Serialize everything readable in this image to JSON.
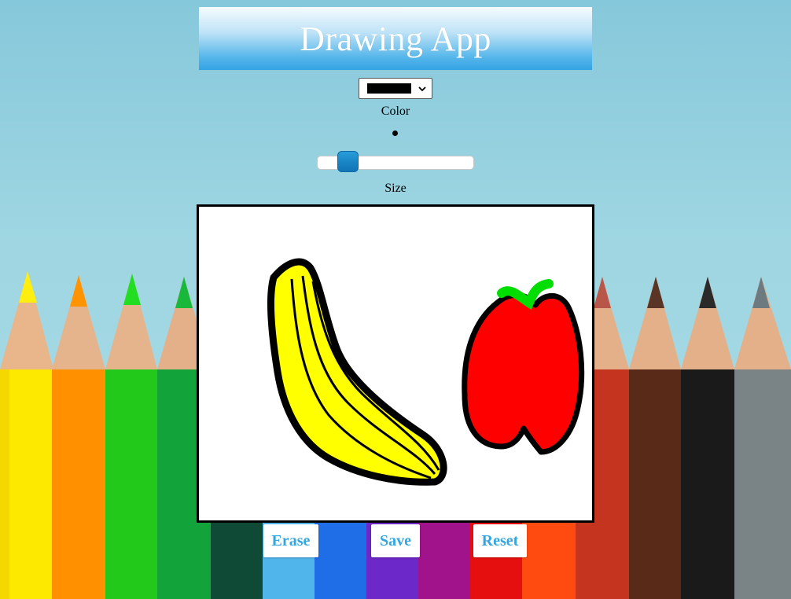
{
  "app": {
    "title": "Drawing App"
  },
  "color_picker": {
    "selected_color": "#000000",
    "label": "Color"
  },
  "size_slider": {
    "label": "Size",
    "value_fraction": 0.15
  },
  "buttons": {
    "erase": "Erase",
    "save": "Save",
    "reset": "Reset"
  },
  "canvas": {
    "drawing_colors": [
      "#000000",
      "#ffff00",
      "#ff0000",
      "#00dd00"
    ]
  },
  "theme": {
    "accent": "#34a6e0",
    "header_top": "#f6fbfe",
    "header_bottom": "#34a3e3"
  }
}
